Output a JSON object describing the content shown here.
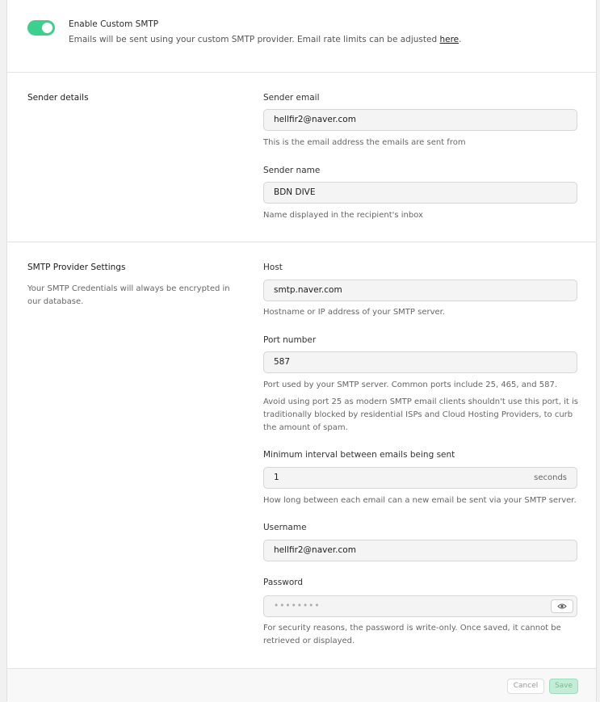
{
  "smtp_toggle": {
    "title": "Enable Custom SMTP",
    "description": "Emails will be sent using your custom SMTP provider. Email rate limits can be adjusted",
    "link": "here",
    "punct": ".",
    "enabled": true
  },
  "sender": {
    "title": "Sender details",
    "email_label": "Sender email",
    "email_value": "hellfir2@naver.com",
    "email_help": "This is the email address the emails are sent from",
    "name_label": "Sender name",
    "name_value": "BDN DIVE",
    "name_help": "Name displayed in the recipient's inbox"
  },
  "provider": {
    "title": "SMTP Provider Settings",
    "description": "Your SMTP Credentials will always be encrypted in our database.",
    "host_label": "Host",
    "host_value": "smtp.naver.com",
    "host_help": "Hostname or IP address of your SMTP server.",
    "port_label": "Port number",
    "port_value": "587",
    "port_help1": "Port used by your SMTP server. Common ports include 25, 465, and 587.",
    "port_help2": "Avoid using port 25 as modern SMTP email clients shouldn't use this port, it is traditionally blocked by residential ISPs and Cloud Hosting Providers, to curb the amount of spam.",
    "interval_label": "Minimum interval between emails being sent",
    "interval_value": "1",
    "interval_suffix": "seconds",
    "interval_help": "How long between each email can a new email be sent via your SMTP server.",
    "username_label": "Username",
    "username_value": "hellfir2@naver.com",
    "password_label": "Password",
    "password_value": "••••••••",
    "password_help": "For security reasons, the password is write-only. Once saved, it cannot be retrieved or displayed."
  },
  "footer": {
    "cancel_label": "Cancel",
    "save_label": "Save"
  },
  "colors": {
    "accent": "#3ecf8e",
    "save_bg": "#c5ecd8"
  },
  "icons": {
    "password_toggle": "eye-icon"
  }
}
